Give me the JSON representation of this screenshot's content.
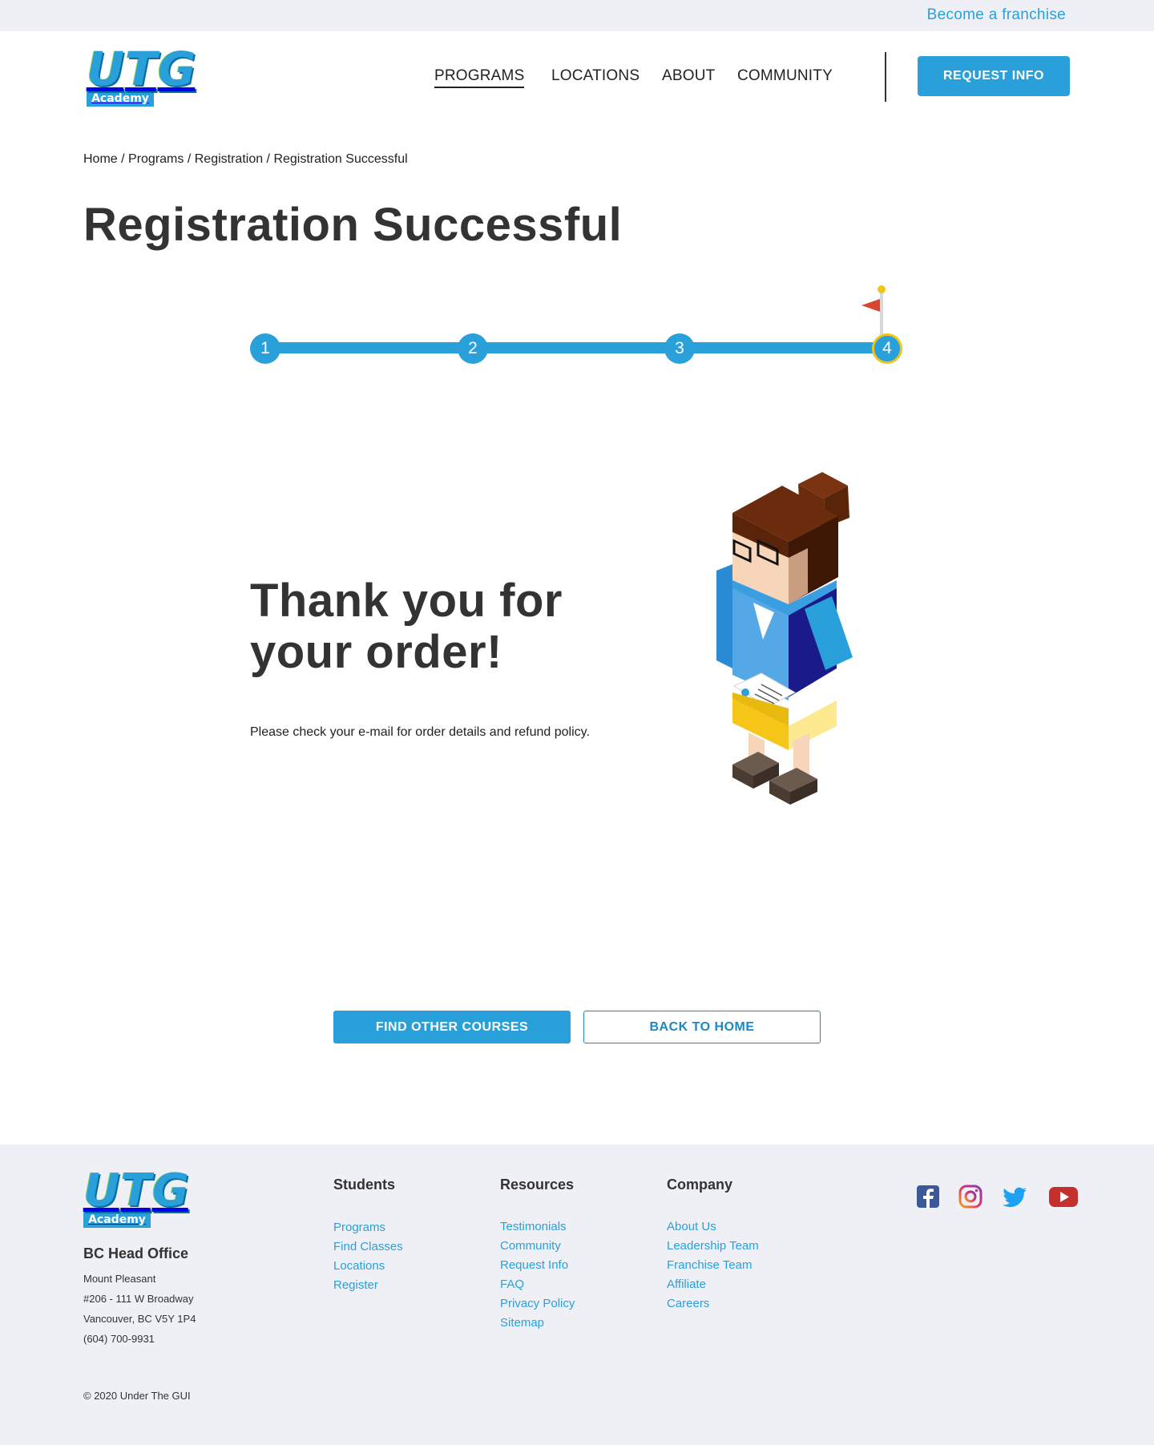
{
  "topbar": {
    "franchise_link": "Become a franchise"
  },
  "logo": {
    "letters": "UTG",
    "subtitle": "Academy"
  },
  "nav": {
    "items": [
      "PROGRAMS",
      "LOCATIONS",
      "ABOUT",
      "COMMUNITY"
    ],
    "active": "PROGRAMS",
    "request_button": "REQUEST INFO"
  },
  "breadcrumb": {
    "items": [
      "Home",
      "Programs",
      "Registration",
      "Registration Successful"
    ],
    "separator": " / "
  },
  "page": {
    "title": "Registration Successful"
  },
  "progress": {
    "steps": [
      "1",
      "2",
      "3",
      "4"
    ],
    "current": 4
  },
  "content": {
    "heading_line1": "Thank you for",
    "heading_line2": "your order!",
    "message": "Please check your e-mail for order details and refund policy."
  },
  "actions": {
    "primary": "FIND OTHER COURSES",
    "secondary": "BACK TO HOME"
  },
  "footer": {
    "office": {
      "title": "BC Head Office",
      "lines": [
        "Mount Pleasant",
        "#206 - 111 W Broadway",
        "Vancouver, BC V5Y 1P4",
        "(604) 700-9931"
      ]
    },
    "columns": [
      {
        "title": "Students",
        "links": [
          "Programs",
          "Find Classes",
          "Locations",
          "Register"
        ]
      },
      {
        "title": "Resources",
        "links": [
          "Testimonials",
          "Community",
          "Request Info",
          "FAQ",
          "Privacy Policy",
          "Sitemap"
        ]
      },
      {
        "title": "Company",
        "links": [
          "About Us",
          "Leadership Team",
          "Franchise Team",
          "Affiliate",
          "Careers"
        ]
      }
    ],
    "social": [
      "facebook-icon",
      "instagram-icon",
      "twitter-icon",
      "youtube-icon"
    ],
    "copyright": "© 2020 Under The GUI"
  },
  "colors": {
    "accent": "#2aa0db",
    "accent_dark": "#1b88c3",
    "footer_bg": "#eef0f5",
    "step_ring": "#f0c419",
    "flag": "#d9452f"
  }
}
